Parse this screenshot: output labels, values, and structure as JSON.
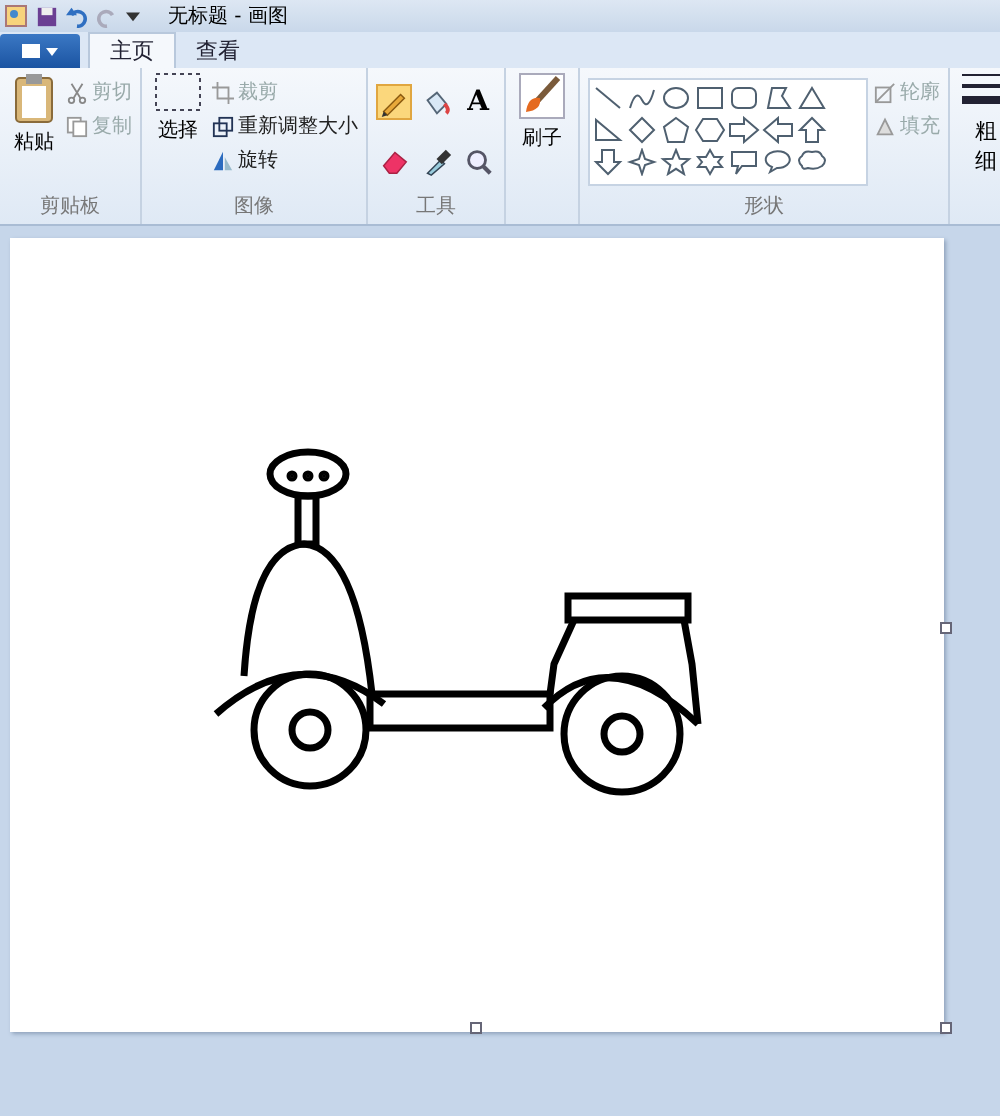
{
  "window": {
    "title": "无标题 - 画图"
  },
  "tabs": [
    {
      "label": "主页",
      "selected": true
    },
    {
      "label": "查看",
      "selected": false
    }
  ],
  "clipboard": {
    "label": "剪贴板",
    "paste": "粘贴",
    "cut": {
      "label": "剪切",
      "disabled": true
    },
    "copy": {
      "label": "复制",
      "disabled": true
    }
  },
  "image": {
    "label": "图像",
    "select": "选择",
    "crop": {
      "label": "裁剪",
      "disabled": true
    },
    "resize": "重新调整大小",
    "rotate": "旋转"
  },
  "tools": {
    "label": "工具",
    "items": [
      {
        "kind": "pencil",
        "selected": true
      },
      {
        "kind": "fill",
        "selected": false
      },
      {
        "kind": "text",
        "label": "A",
        "selected": false
      },
      {
        "kind": "eraser",
        "selected": false
      },
      {
        "kind": "picker",
        "selected": false
      },
      {
        "kind": "magnifier",
        "selected": false
      }
    ]
  },
  "brushes": {
    "label": "刷子"
  },
  "shapes": {
    "label": "形状",
    "outline": {
      "label": "轮廓",
      "disabled": true
    },
    "fill": {
      "label": "填充",
      "disabled": true
    }
  },
  "size": {
    "label": "粗细"
  }
}
